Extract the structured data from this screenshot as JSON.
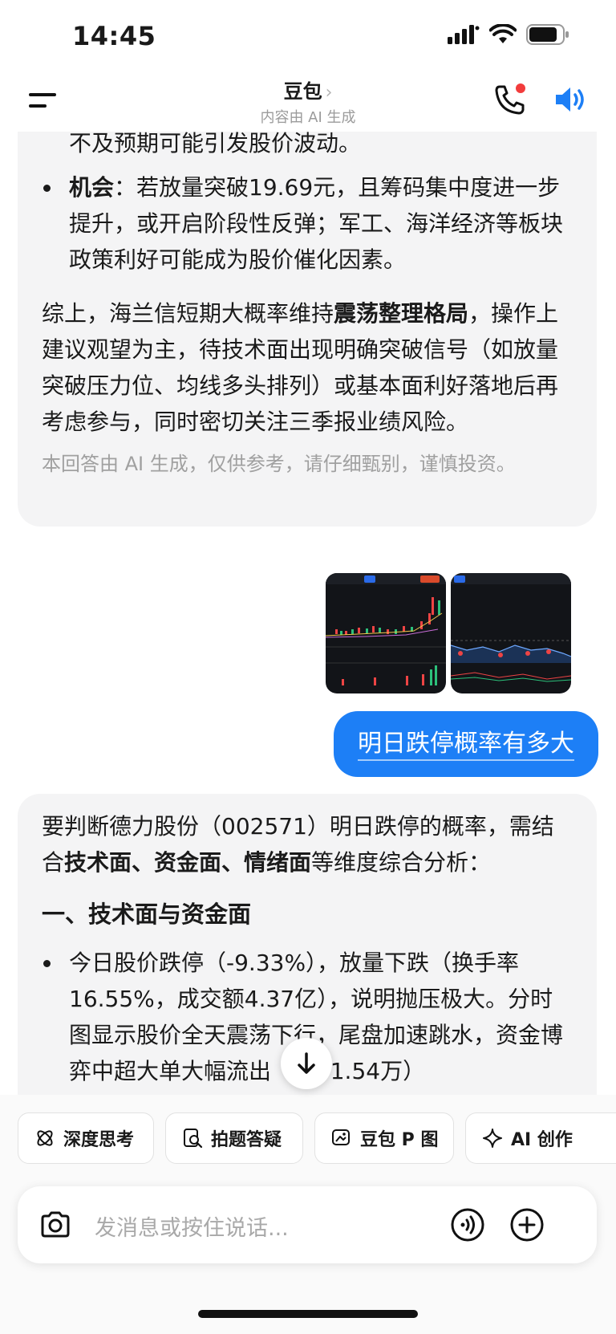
{
  "status_bar": {
    "time": "14:45"
  },
  "nav": {
    "title": "豆包",
    "chevron": "›",
    "subtitle": "内容由 AI 生成"
  },
  "bubble1": {
    "line0": "不及预期可能引发股价波动。",
    "opp_label": "机会",
    "opp_text": "：若放量突破19.69元，且筹码集中度进一步提升，或开启阶段性反弹；军工、海洋经济等板块政策利好可能成为股价催化因素。",
    "summary_a": "综上，海兰信短期大概率维持",
    "summary_bold": "震荡整理格局",
    "summary_b": "，操作上建议观望为主，待技术面出现明确突破信号（如放量突破压力位、均线多头排列）或基本面利好落地后再考虑参与，同时密切关注三季报业绩风险。",
    "disclaimer": "本回答由 AI 生成，仅供参考，请仔细甄别，谨慎投资。"
  },
  "images": [
    {
      "name": "kline-chart-thumbnail"
    },
    {
      "name": "intraday-chart-thumbnail"
    }
  ],
  "user_message": "明日跌停概率有多大",
  "bubble2": {
    "intro_a": "要判断德力股份（002571）明日跌停的概率，需结合",
    "intro_bold": "技术面、资金面、情绪面",
    "intro_b": "等维度综合分析：",
    "heading": "一、技术面与资金面",
    "bullet": "今日股价跌停（-9.33%），放量下跌（换手率16.55%，成交额4.37亿），说明抛压极大。分时图显示股价全天震荡下行，尾盘加速跳水，资金博弈中超大单大幅流出（-641.54万）"
  },
  "chips": [
    "深度思考",
    "拍题答疑",
    "豆包 P 图",
    "AI 创作"
  ],
  "input": {
    "placeholder": "发消息或按住说话..."
  },
  "colors": {
    "accent": "#1d7ff6",
    "bubble_bg": "#f4f4f5",
    "red_dot": "#f23c3c"
  }
}
